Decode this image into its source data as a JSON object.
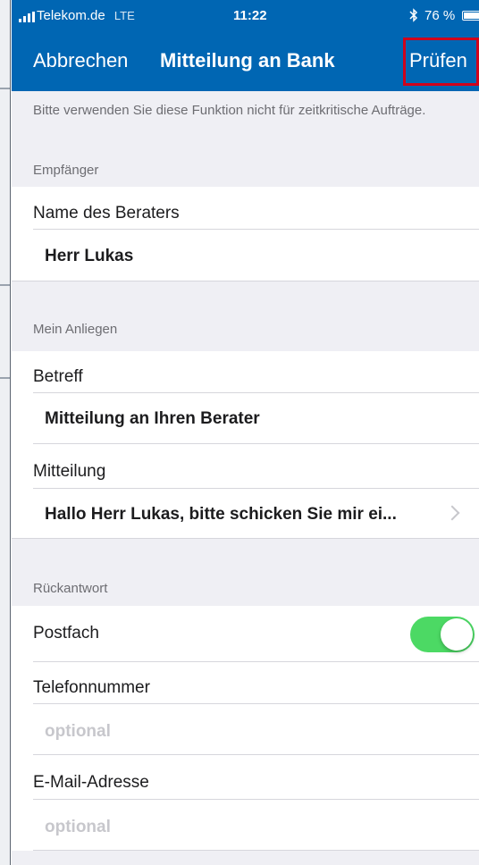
{
  "status_bar": {
    "carrier": "Telekom.de",
    "network": "LTE",
    "time": "11:22",
    "bluetooth_icon": "bluetooth-icon",
    "battery": "76 %"
  },
  "navbar": {
    "cancel_label": "Abbrechen",
    "title": "Mitteilung an Bank",
    "check_label": "Prüfen"
  },
  "notice": "Bitte verwenden Sie diese Funktion nicht für zeitkritische Aufträge.",
  "recipient_section": {
    "header": "Empfänger",
    "advisor_label": "Name des Beraters",
    "advisor_value": "Herr Lukas"
  },
  "request_section": {
    "header": "Mein Anliegen",
    "subject_label": "Betreff",
    "subject_value": "Mitteilung an Ihren Berater",
    "message_label": "Mitteilung",
    "message_value": "Hallo Herr Lukas,  bitte schicken Sie mir ei..."
  },
  "reply_section": {
    "header": "Rückantwort",
    "mailbox_label": "Postfach",
    "mailbox_enabled": true,
    "phone_label": "Telefonnummer",
    "phone_placeholder": "optional",
    "email_label": "E-Mail-Adresse",
    "email_placeholder": "optional"
  },
  "colors": {
    "header_blue": "#0066b3",
    "toggle_green": "#4cd964",
    "highlight_red": "#d0021b",
    "grouped_background": "#efeff4"
  }
}
